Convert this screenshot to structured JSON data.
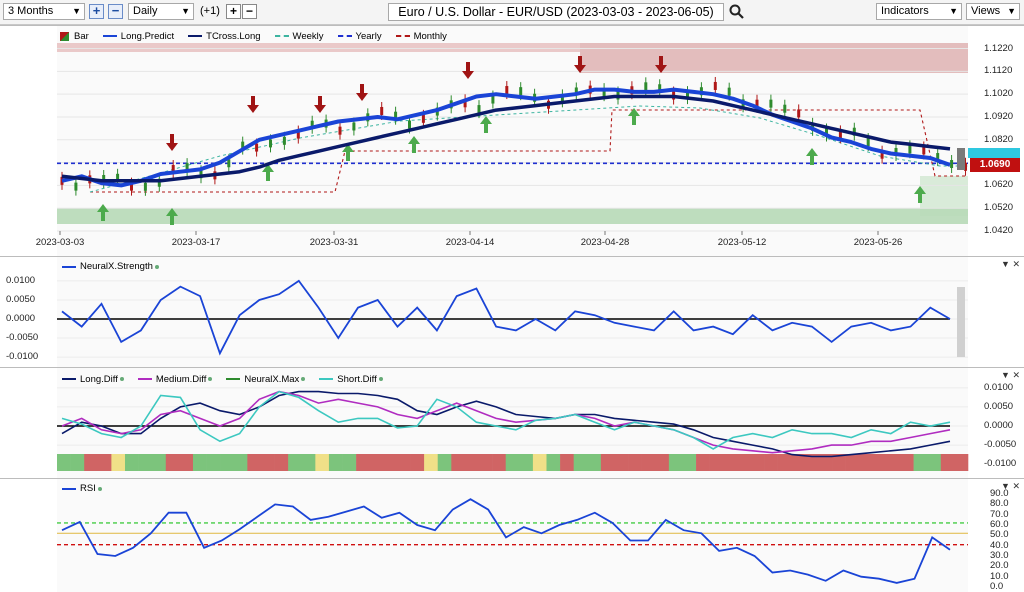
{
  "toolbar": {
    "period": "3 Months",
    "interval": "Daily",
    "offset": "(+1)",
    "title": "Euro / U.S. Dollar - EUR/USD (2023-03-03 - 2023-06-05)",
    "indicators": "Indicators",
    "views": "Views"
  },
  "price_panel": {
    "legend": [
      {
        "name": "Bar",
        "color": "#2e8b2e",
        "style": "box"
      },
      {
        "name": "Long.Predict",
        "color": "#1a44d6",
        "style": "solid"
      },
      {
        "name": "TCross.Long",
        "color": "#0a1a6a",
        "style": "solid"
      },
      {
        "name": "Weekly",
        "color": "#3cb4a0",
        "style": "dash"
      },
      {
        "name": "Yearly",
        "color": "#1f2fd0",
        "style": "dash"
      },
      {
        "name": "Monthly",
        "color": "#b01818",
        "style": "dash"
      }
    ],
    "y_labels": [
      "1.1220",
      "1.1120",
      "1.1020",
      "1.0920",
      "1.0820",
      "1.0720",
      "1.0620",
      "1.0520",
      "1.0420"
    ],
    "current_price": "1.0690",
    "x_labels": [
      "2023-03-03",
      "2023-03-17",
      "2023-03-31",
      "2023-04-14",
      "2023-04-28",
      "2023-05-12",
      "2023-05-26"
    ]
  },
  "strength_panel": {
    "legend": "NeuralX.Strength",
    "y_labels": [
      "0.0100",
      "0.0050",
      "0.0000",
      "-0.0050",
      "-0.0100"
    ]
  },
  "diff_panel": {
    "legend": [
      {
        "name": "Long.Diff",
        "color": "#0a1a6a"
      },
      {
        "name": "Medium.Diff",
        "color": "#b02cc0"
      },
      {
        "name": "NeuralX.Max",
        "color": "#2e8b2e"
      },
      {
        "name": "Short.Diff",
        "color": "#3cc8c0"
      }
    ],
    "y_labels": [
      "0.0100",
      "0.0050",
      "0.0000",
      "-0.0050",
      "-0.0100"
    ]
  },
  "rsi_panel": {
    "legend": "RSI",
    "y_labels": [
      "90.0",
      "80.0",
      "70.0",
      "60.0",
      "50.0",
      "40.0",
      "30.0",
      "20.0",
      "10.0",
      "0.0"
    ]
  },
  "chart_data": [
    {
      "type": "line",
      "title": "Euro / U.S. Dollar - EUR/USD (2023-03-03 - 2023-06-05)",
      "ylim": [
        1.042,
        1.124
      ],
      "series": [
        {
          "name": "Long.Predict",
          "values": [
            1.064,
            1.066,
            1.063,
            1.062,
            1.064,
            1.067,
            1.068,
            1.069,
            1.072,
            1.077,
            1.082,
            1.084,
            1.086,
            1.088,
            1.09,
            1.091,
            1.092,
            1.091,
            1.093,
            1.095,
            1.098,
            1.101,
            1.102,
            1.101,
            1.1,
            1.101,
            1.102,
            1.104,
            1.104,
            1.103,
            1.103,
            1.104,
            1.103,
            1.102,
            1.1,
            1.097,
            1.093,
            1.09,
            1.087,
            1.083,
            1.081,
            1.078,
            1.076,
            1.075,
            1.074,
            1.071
          ]
        },
        {
          "name": "TCross.Long",
          "values": [
            1.066,
            1.065,
            1.064,
            1.064,
            1.064,
            1.064,
            1.065,
            1.066,
            1.067,
            1.068,
            1.07,
            1.073,
            1.075,
            1.077,
            1.079,
            1.081,
            1.083,
            1.085,
            1.087,
            1.089,
            1.091,
            1.093,
            1.095,
            1.096,
            1.097,
            1.098,
            1.099,
            1.1,
            1.101,
            1.101,
            1.101,
            1.101,
            1.1,
            1.099,
            1.097,
            1.095,
            1.093,
            1.091,
            1.089,
            1.087,
            1.085,
            1.083,
            1.081,
            1.08,
            1.079,
            1.078
          ]
        }
      ]
    },
    {
      "type": "line",
      "ylim": [
        -0.0105,
        0.0105
      ],
      "series": [
        {
          "name": "NeuralX.Strength",
          "values": [
            0.002,
            -0.002,
            0.004,
            -0.006,
            -0.003,
            0.005,
            0.0085,
            0.006,
            -0.009,
            0.001,
            0.005,
            0.0065,
            0.01,
            0.003,
            -0.005,
            0.003,
            0.005,
            -0.002,
            0.003,
            -0.003,
            0.006,
            0.008,
            -0.002,
            -0.003,
            0.0,
            -0.003,
            0.002,
            0.001,
            -0.001,
            -0.002,
            -0.003,
            0.002,
            -0.003,
            -0.002,
            -0.004,
            0.001,
            -0.003,
            -0.001,
            -0.002,
            -0.006,
            -0.002,
            -0.001,
            -0.003,
            -0.002,
            0.003,
            0.0
          ]
        }
      ]
    },
    {
      "type": "line",
      "ylim": [
        -0.011,
        0.011
      ],
      "series": [
        {
          "name": "Long.Diff",
          "values": [
            -0.002,
            0.001,
            0.0,
            -0.002,
            -0.002,
            0.002,
            0.005,
            0.006,
            0.004,
            0.003,
            0.005,
            0.008,
            0.009,
            0.009,
            0.0085,
            0.0085,
            0.008,
            0.007,
            0.004,
            0.003,
            0.005,
            0.0065,
            0.005,
            0.003,
            0.0025,
            0.002,
            0.003,
            0.003,
            0.002,
            0.0015,
            0.001,
            0.0005,
            -0.001,
            -0.003,
            -0.004,
            -0.005,
            -0.006,
            -0.0075,
            -0.008,
            -0.008,
            -0.0075,
            -0.007,
            -0.0065,
            -0.006,
            -0.005,
            -0.004
          ]
        },
        {
          "name": "Medium.Diff",
          "values": [
            0.0,
            0.002,
            -0.001,
            -0.002,
            -0.001,
            0.003,
            0.004,
            0.002,
            0.0,
            0.002,
            0.007,
            0.009,
            0.008,
            0.006,
            0.007,
            0.006,
            0.005,
            0.003,
            0.002,
            0.004,
            0.006,
            0.004,
            0.002,
            0.001,
            0.0015,
            0.002,
            0.003,
            0.002,
            0.0,
            0.001,
            0.0,
            -0.001,
            -0.003,
            -0.005,
            -0.006,
            -0.0065,
            -0.007,
            -0.0065,
            -0.006,
            -0.005,
            -0.005,
            -0.004,
            -0.004,
            -0.003,
            -0.002,
            -0.001
          ]
        },
        {
          "name": "Short.Diff",
          "values": [
            0.002,
            0.0005,
            -0.002,
            -0.003,
            0.0,
            0.008,
            0.0075,
            -0.001,
            -0.004,
            -0.002,
            0.005,
            0.009,
            0.0075,
            0.004,
            0.001,
            0.002,
            0.002,
            -0.0005,
            0.0,
            0.007,
            0.005,
            0.001,
            0.0,
            -0.001,
            0.0015,
            0.002,
            0.003,
            0.001,
            -0.001,
            0.001,
            0.0,
            -0.001,
            -0.003,
            -0.006,
            -0.003,
            -0.002,
            -0.003,
            -0.001,
            -0.002,
            -0.002,
            -0.003,
            -0.001,
            -0.002,
            0.001,
            0.0,
            0.001
          ]
        }
      ]
    },
    {
      "type": "line",
      "ylim": [
        0,
        92
      ],
      "series": [
        {
          "name": "RSI",
          "values": [
            55,
            63,
            32,
            30,
            38,
            52,
            72,
            72,
            38,
            45,
            56,
            68,
            80,
            78,
            65,
            68,
            73,
            78,
            67,
            72,
            60,
            55,
            75,
            85,
            75,
            48,
            58,
            52,
            60,
            65,
            72,
            62,
            45,
            45,
            65,
            55,
            52,
            35,
            38,
            30,
            14,
            16,
            12,
            6,
            16,
            10,
            8,
            4,
            8,
            48,
            36
          ]
        }
      ]
    }
  ]
}
